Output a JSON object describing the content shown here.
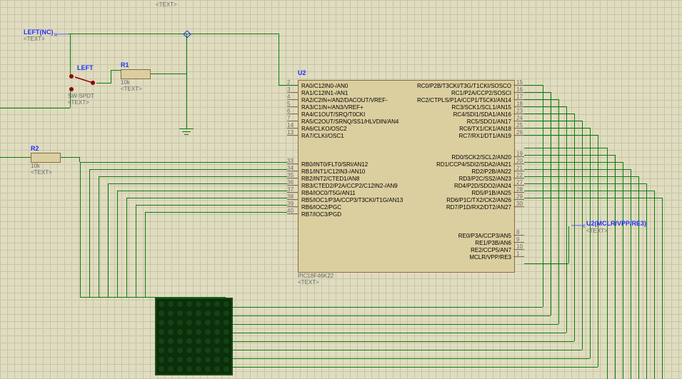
{
  "labels": {
    "left_nc": "LEFT(NC)",
    "text_ph": "<TEXT>",
    "sw_name": "LEFT",
    "sw_part": "SW-SPDT",
    "r1_name": "R1",
    "r1_val": "10k",
    "r2_name": "R2",
    "r2_val": "10k",
    "u2_name": "U2",
    "u2_part": "PIC18F46K22",
    "u2_mclr": "U2(MCLR/VPP/RE3)"
  },
  "ic": {
    "left_pins": [
      {
        "num": "2",
        "lbl": "RA0/C12IN0-/AN0"
      },
      {
        "num": "3",
        "lbl": "RA1/C12IN1-/AN1"
      },
      {
        "num": "4",
        "lbl": "RA2/C2IN+/AN2/DACOUT/VREF-"
      },
      {
        "num": "5",
        "lbl": "RA3/C1IN+/AN3/VREF+"
      },
      {
        "num": "6",
        "lbl": "RA4/C1OUT/SRQ/T0CKI"
      },
      {
        "num": "7",
        "lbl": "RA5/C2OUT/SRNQ/SS1/HLVDIN/AN4"
      },
      {
        "num": "14",
        "lbl": "RA6/CLKO/OSC2"
      },
      {
        "num": "13",
        "lbl": "RA7/CLKI/OSC1"
      },
      {
        "num": "33",
        "lbl": "RB0/INT0/FLT0/SRI/AN12"
      },
      {
        "num": "34",
        "lbl": "RB1/INT1/C12IN3-/AN10"
      },
      {
        "num": "35",
        "lbl": "RB2/INT2/CTED1/AN8"
      },
      {
        "num": "36",
        "lbl": "RB3/CTED2/P2A/CCP2/C12IN2-/AN9"
      },
      {
        "num": "37",
        "lbl": "RB4/IOC0/T5G/AN11"
      },
      {
        "num": "38",
        "lbl": "RB5/IOC1/P3A/CCP3/T3CKI/T1G/AN13"
      },
      {
        "num": "39",
        "lbl": "RB6/IOC2/PGC"
      },
      {
        "num": "40",
        "lbl": "RB7/IOC3/PGD"
      }
    ],
    "right_pins": [
      {
        "num": "15",
        "lbl": "RC0/P2B/T3CKI/T3G/T1CKI/SOSCO"
      },
      {
        "num": "16",
        "lbl": "RC1/P2A/CCP2/SOSCI"
      },
      {
        "num": "17",
        "lbl": "RC2/CTPLS/P1A/CCP1/T5CKI/AN14"
      },
      {
        "num": "18",
        "lbl": "RC3/SCK1/SCL1/AN15"
      },
      {
        "num": "23",
        "lbl": "RC4/SDI1/SDA1/AN16"
      },
      {
        "num": "24",
        "lbl": "RC5/SDO1/AN17"
      },
      {
        "num": "25",
        "lbl": "RC6/TX1/CK1/AN18"
      },
      {
        "num": "26",
        "lbl": "RC7/RX1/DT1/AN19"
      },
      {
        "num": "19",
        "lbl": "RD0/SCK2/SCL2/AN20"
      },
      {
        "num": "20",
        "lbl": "RD1/CCP4/SDI2/SDA2/AN21"
      },
      {
        "num": "21",
        "lbl": "RD2/P2B/AN22"
      },
      {
        "num": "22",
        "lbl": "RD3/P2C/SS2/AN23"
      },
      {
        "num": "27",
        "lbl": "RD4/P2D/SDO2/AN24"
      },
      {
        "num": "28",
        "lbl": "RD5/P1B/AN25"
      },
      {
        "num": "29",
        "lbl": "RD6/P1C/TX2/CK2/AN26"
      },
      {
        "num": "30",
        "lbl": "RD7/P1D/RX2/DT2/AN27"
      },
      {
        "num": "8",
        "lbl": "RE0/P3A/CCP3/AN5"
      },
      {
        "num": "9",
        "lbl": "RE1/P3B/AN6"
      },
      {
        "num": "10",
        "lbl": "RE2/CCP5/AN7"
      },
      {
        "num": "1",
        "lbl": "MCLR/VPP/RE3"
      }
    ]
  }
}
